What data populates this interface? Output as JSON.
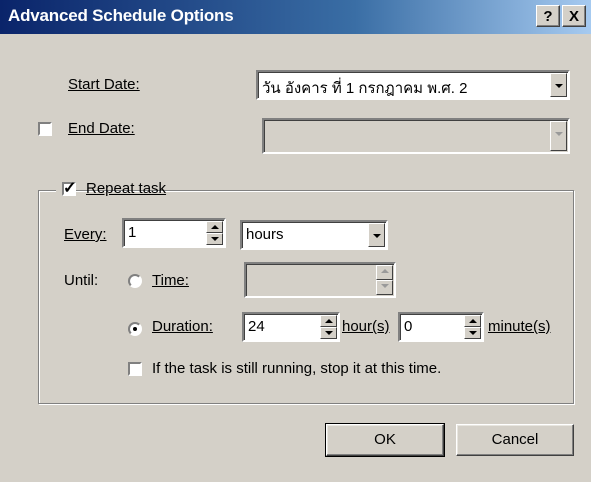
{
  "dialog": {
    "title": "Advanced Schedule Options",
    "help_btn": "?",
    "close_btn": "X"
  },
  "start_date": {
    "label": "Start Date:",
    "value": "วัน อังคาร ที่ 1 กรกฎาคม พ.ศ. 2"
  },
  "end_date": {
    "label": "End Date:",
    "checked": false,
    "value": ""
  },
  "repeat": {
    "label": "Repeat task",
    "checked": true,
    "every_label": "Every:",
    "every_value": "1",
    "unit_value": "hours",
    "until_label": "Until:",
    "time_label": "Time:",
    "time_value": "",
    "duration_label": "Duration:",
    "duration_hours": "24",
    "hours_label": "hour(s)",
    "duration_minutes": "0",
    "minutes_label": "minute(s)",
    "selected": "duration",
    "stop_label": "If the task is still running, stop it at this time.",
    "stop_checked": false
  },
  "buttons": {
    "ok": "OK",
    "cancel": "Cancel"
  },
  "colors": {
    "face": "#d4d0c8",
    "title_start": "#0a246a",
    "title_end": "#a6caf0"
  }
}
